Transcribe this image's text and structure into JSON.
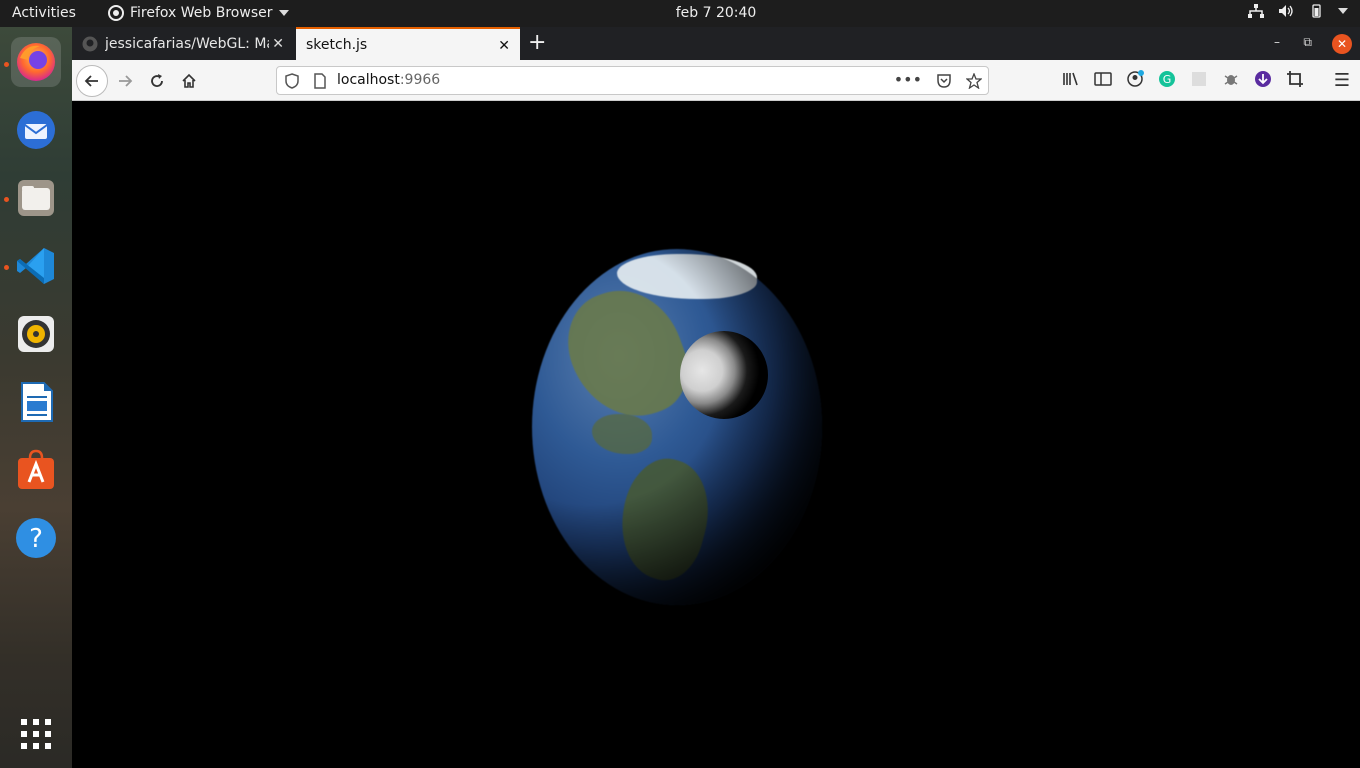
{
  "topbar": {
    "activities": "Activities",
    "app_name": "Firefox Web Browser",
    "clock": "feb 7  20:40"
  },
  "dock": {
    "items": [
      {
        "name": "Firefox",
        "icon": "firefox-icon",
        "running": true,
        "active": true
      },
      {
        "name": "Thunderbird",
        "icon": "mail-icon",
        "running": false
      },
      {
        "name": "Files",
        "icon": "folder-icon",
        "running": true
      },
      {
        "name": "Visual Studio Code",
        "icon": "vscode-icon",
        "running": true
      },
      {
        "name": "Rhythmbox",
        "icon": "music-icon",
        "running": false
      },
      {
        "name": "LibreOffice Writer",
        "icon": "document-icon",
        "running": false
      },
      {
        "name": "Ubuntu Software",
        "icon": "software-store-icon",
        "running": false
      },
      {
        "name": "Help",
        "icon": "help-icon",
        "running": false
      },
      {
        "name": "Show Applications",
        "icon": "apps-grid-icon",
        "running": false
      }
    ]
  },
  "browser": {
    "tabs": [
      {
        "label": "jessicafarias/WebGL: Ma",
        "active": false
      },
      {
        "label": "sketch.js",
        "active": true
      }
    ],
    "url_host": "localhost",
    "url_port": ":9966"
  },
  "colors": {
    "accent": "#e66000",
    "ubuntu_orange": "#e95420",
    "canvas_bg": "#000000"
  }
}
